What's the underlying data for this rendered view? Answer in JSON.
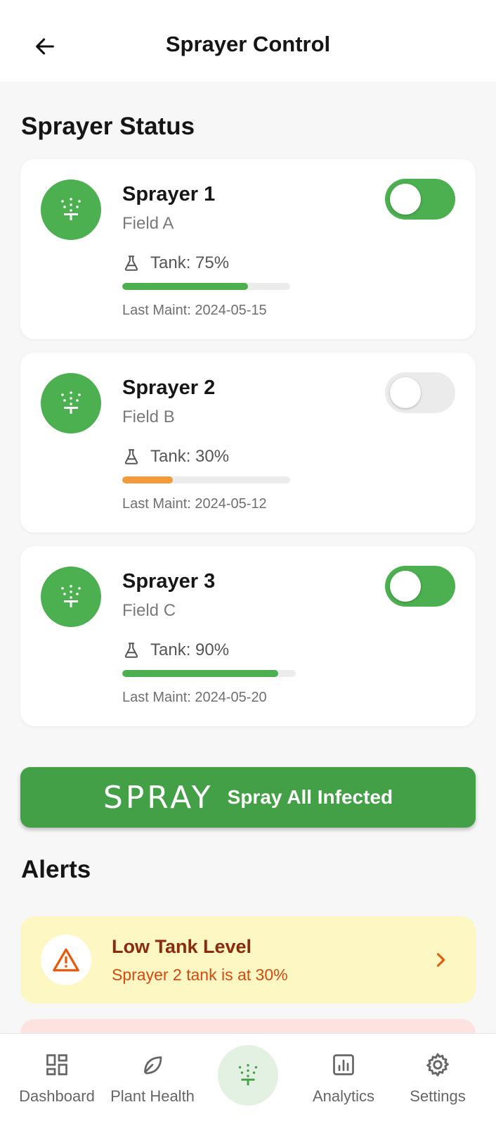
{
  "header": {
    "title": "Sprayer Control",
    "back_icon": "arrow-left-icon"
  },
  "status_section": {
    "title": "Sprayer Status"
  },
  "sprayers": [
    {
      "name": "Sprayer 1",
      "field": "Field A",
      "tank_label": "Tank: 75%",
      "tank_level": 0.75,
      "tank_color": "#4caf50",
      "last_maint": "Last Maint: 2024-05-15",
      "enabled": true
    },
    {
      "name": "Sprayer 2",
      "field": "Field B",
      "tank_label": "Tank: 30%",
      "tank_level": 0.3,
      "tank_color": "#f39a3b",
      "last_maint": "Last Maint: 2024-05-12",
      "enabled": false
    },
    {
      "name": "Sprayer 3",
      "field": "Field C",
      "tank_label": "Tank: 90%",
      "tank_level": 0.9,
      "tank_color": "#4caf50",
      "last_maint": "Last Maint: 2024-05-20",
      "enabled": true
    }
  ],
  "spray_all": {
    "word": "SPRAY",
    "label": "Spray All Infected"
  },
  "alerts_section": {
    "title": "Alerts"
  },
  "alerts": [
    {
      "title": "Low Tank Level",
      "message": "Sprayer 2 tank is at 30%",
      "icon": "warning-triangle-icon",
      "bg": "#fdf7c3"
    }
  ],
  "nav": {
    "dashboard": "Dashboard",
    "plant_health": "Plant Health",
    "analytics": "Analytics",
    "settings": "Settings"
  },
  "colors": {
    "primary": "#43a047",
    "accent_green": "#4caf50",
    "warning_orange": "#f39a3b",
    "toggle_off": "#ebebeb"
  }
}
